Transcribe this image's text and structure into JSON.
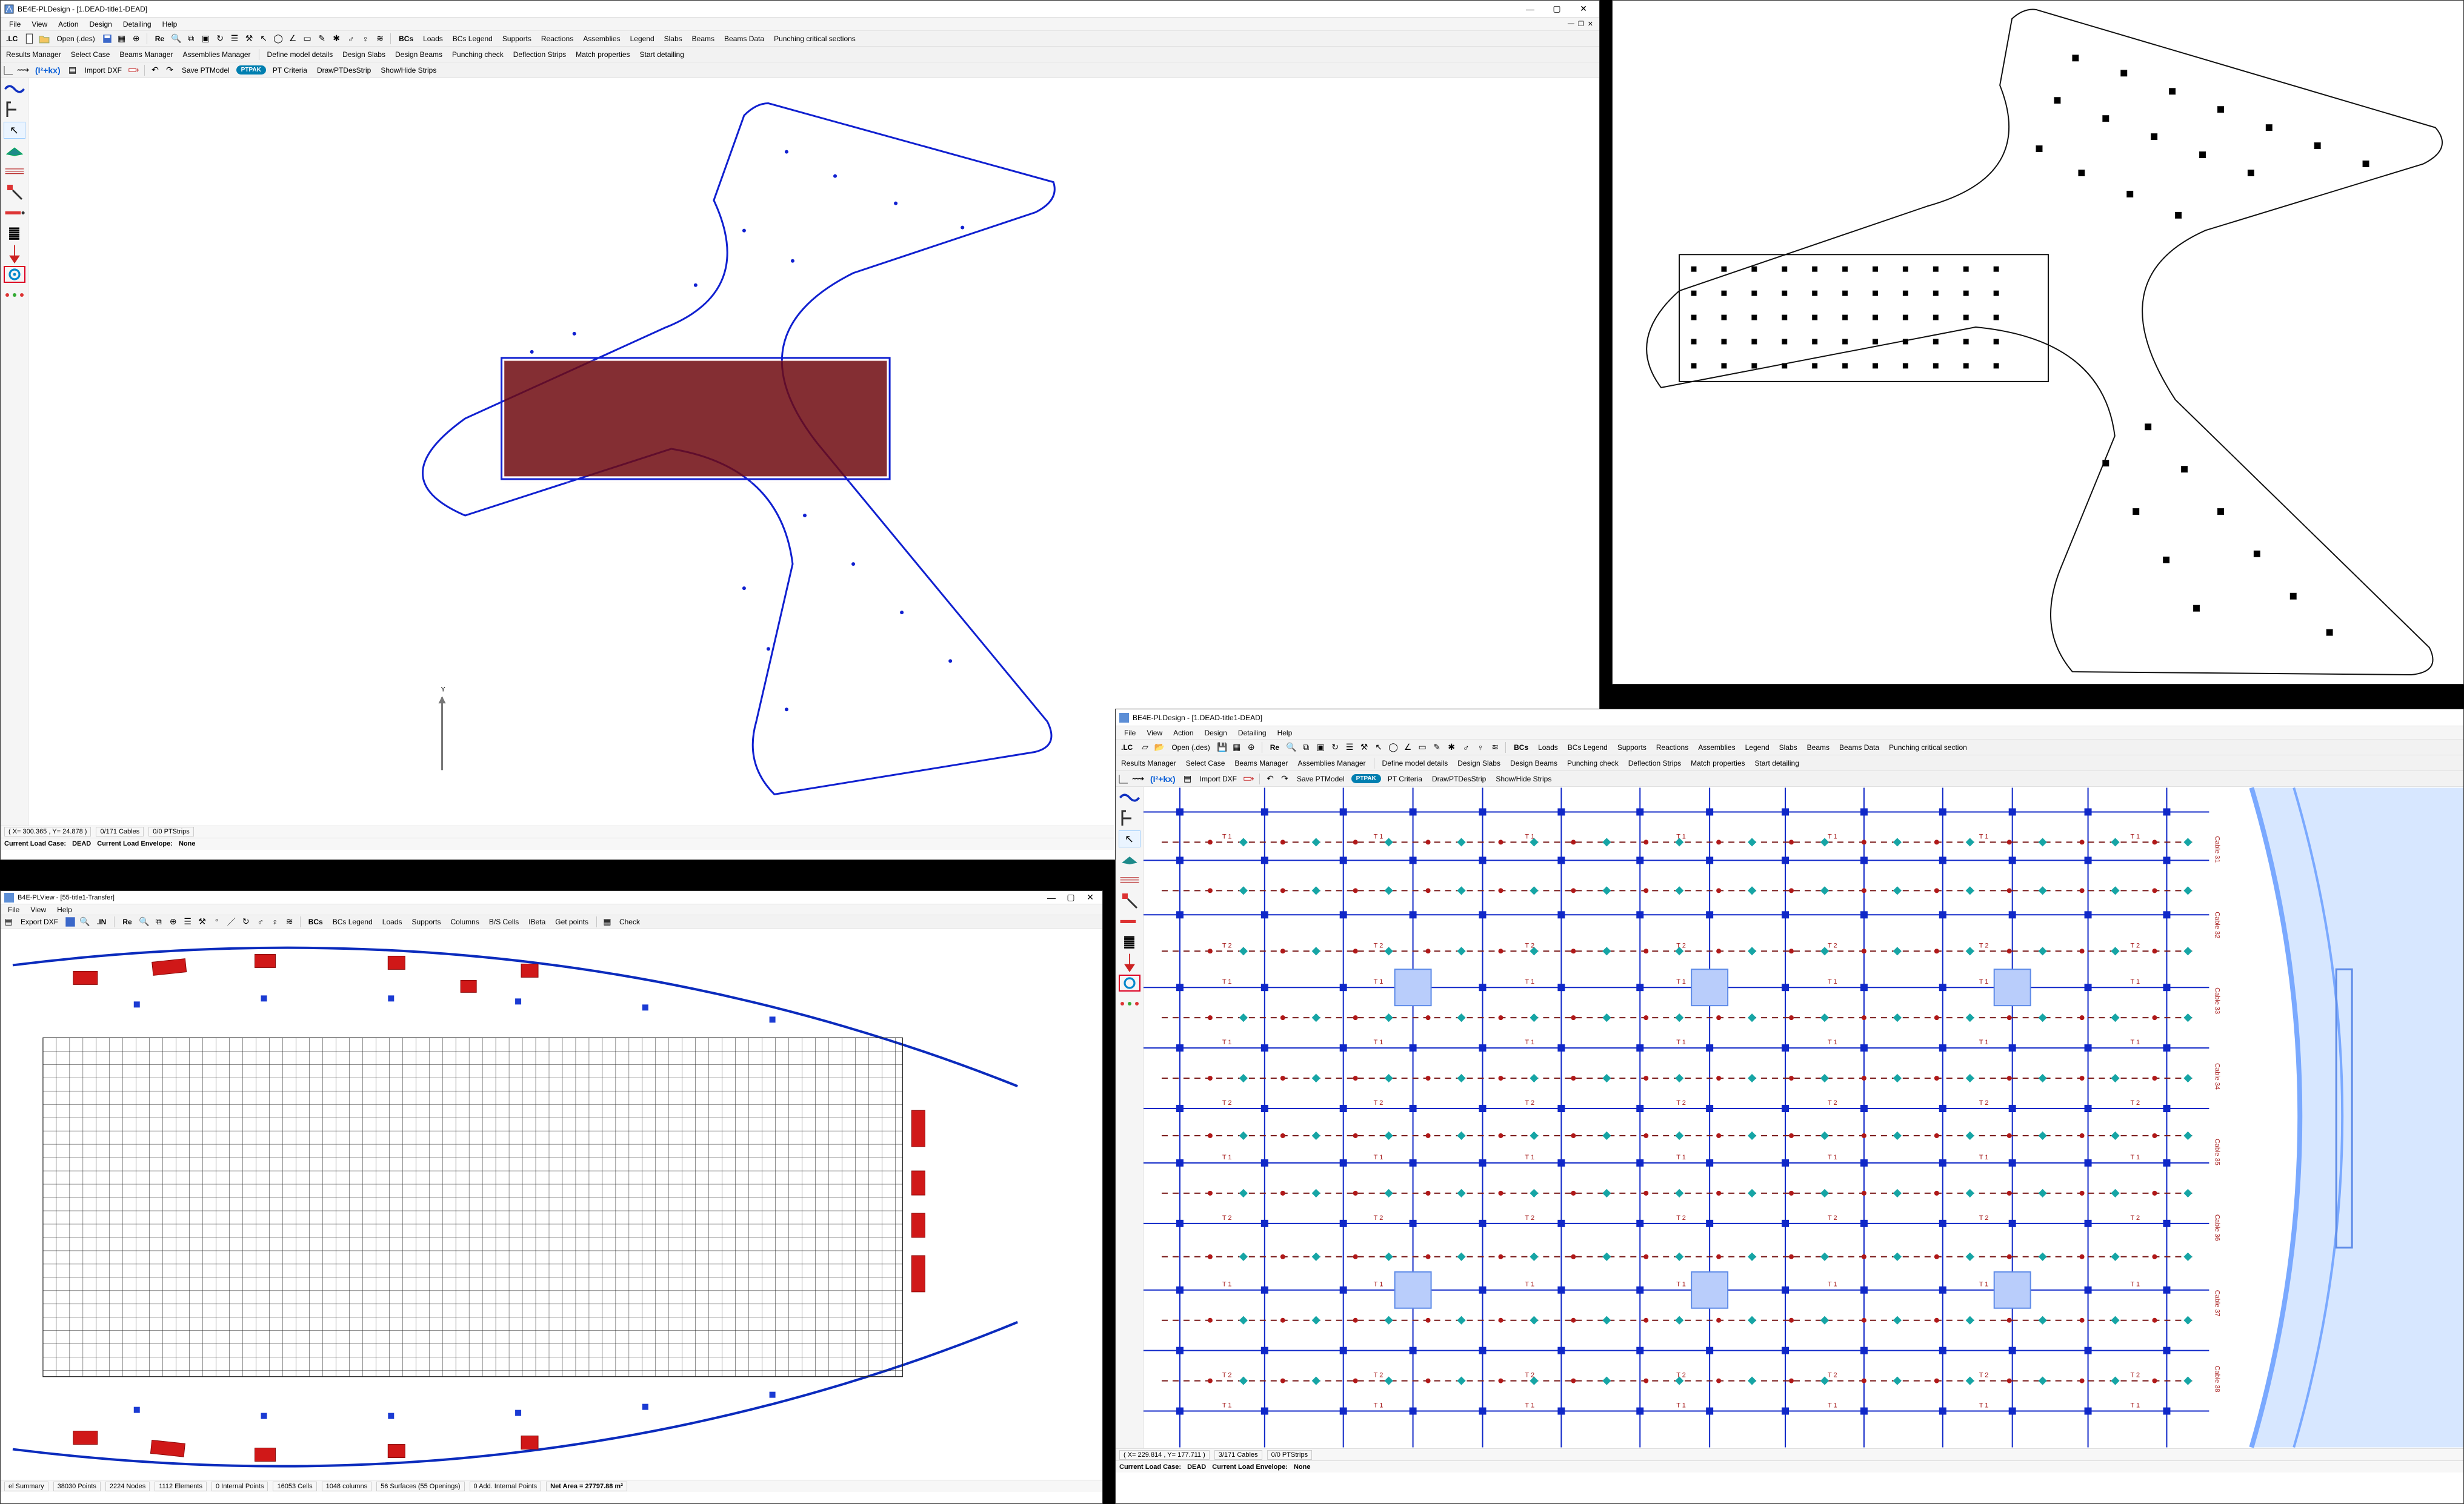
{
  "app1": {
    "title": "BE4E-PLDesign - [1.DEAD-title1-DEAD]",
    "menus": [
      "File",
      "View",
      "Action",
      "Design",
      "Detailing",
      "Help"
    ],
    "tb1": {
      "lc": ".LC",
      "open": "Open (.des)",
      "re": "Re",
      "bcs": "BCs",
      "items": [
        "Loads",
        "BCs Legend",
        "Supports",
        "Reactions",
        "Assemblies",
        "Legend",
        "Slabs",
        "Beams",
        "Beams Data",
        "Punching critical sections"
      ]
    },
    "tb2": [
      "Results Manager",
      "Select Case",
      "Beams Manager",
      "Assemblies Manager",
      "Define model details",
      "Design Slabs",
      "Design Beams",
      "Punching check",
      "Deflection Strips",
      "Match properties",
      "Start detailing"
    ],
    "tb3": {
      "formula": "(I²+kx)",
      "importdxf": "Import DXF",
      "savept": "Save PTModel",
      "ptpak": "PTPAK",
      "items": [
        "PT Criteria",
        "DrawPTDesStrip",
        "Show/Hide Strips"
      ]
    },
    "status": {
      "coord": "( X= 300.365 , Y= 24.878 )",
      "cables": "0/171 Cables",
      "strips": "0/0 PTStrips"
    },
    "status2": {
      "lc_label": "Current Load Case:",
      "lc_val": "DEAD",
      "env_label": "Current Load Envelope:",
      "env_val": "None"
    },
    "axis_y": "Y"
  },
  "app2": {
    "title": "B4E-PLView - [55-title1-Transfer]",
    "menus": [
      "File",
      "View",
      "Help"
    ],
    "tb": {
      "export": "Export DXF",
      "in": ".IN",
      "re": "Re",
      "bcs": "BCs",
      "items": [
        "BCs Legend",
        "Loads",
        "Supports",
        "Columns",
        "B/S Cells",
        "IBeta",
        "Get points"
      ],
      "check": "Check"
    },
    "status_cells": [
      "el Summary",
      "38030 Points",
      "2224 Nodes",
      "1112 Elements",
      "0 Internal Points",
      "16053 Cells",
      "1048 columns",
      "56 Surfaces (55 Openings)",
      "0 Add. Internal Points"
    ],
    "netarea_label": "Net Area = ",
    "netarea_val": "27797.88 m²"
  },
  "app3": {
    "title": "BE4E-PLDesign - [1.DEAD-title1-DEAD]",
    "menus": [
      "File",
      "View",
      "Action",
      "Design",
      "Detailing",
      "Help"
    ],
    "tb1": {
      "lc": ".LC",
      "open": "Open (.des)",
      "re": "Re",
      "bcs": "BCs",
      "items": [
        "Loads",
        "BCs Legend",
        "Supports",
        "Reactions",
        "Assemblies",
        "Legend",
        "Slabs",
        "Beams",
        "Beams Data",
        "Punching critical section"
      ]
    },
    "tb2": [
      "Results Manager",
      "Select Case",
      "Beams Manager",
      "Assemblies Manager",
      "Define model details",
      "Design Slabs",
      "Design Beams",
      "Punching check",
      "Deflection Strips",
      "Match properties",
      "Start detailing"
    ],
    "tb3": {
      "formula": "(I²+kx)",
      "importdxf": "Import DXF",
      "savept": "Save PTModel",
      "ptpak": "PTPAK",
      "items": [
        "PT Criteria",
        "DrawPTDesStrip",
        "Show/Hide Strips"
      ]
    },
    "tendon_labels": [
      "T 1",
      "T 2"
    ],
    "cable_labels": [
      "Cable 31",
      "Cable 32",
      "Cable 33",
      "Cable 34",
      "Cable 35",
      "Cable 36",
      "Cable 37",
      "Cable 38"
    ],
    "status": {
      "coord": "( X= 229.814 , Y= 177.711 )",
      "cables": "3/171 Cables",
      "strips": "0/0 PTStrips"
    },
    "status2": {
      "lc_label": "Current Load Case:",
      "lc_val": "DEAD",
      "env_label": "Current Load Envelope:",
      "env_val": "None"
    }
  }
}
